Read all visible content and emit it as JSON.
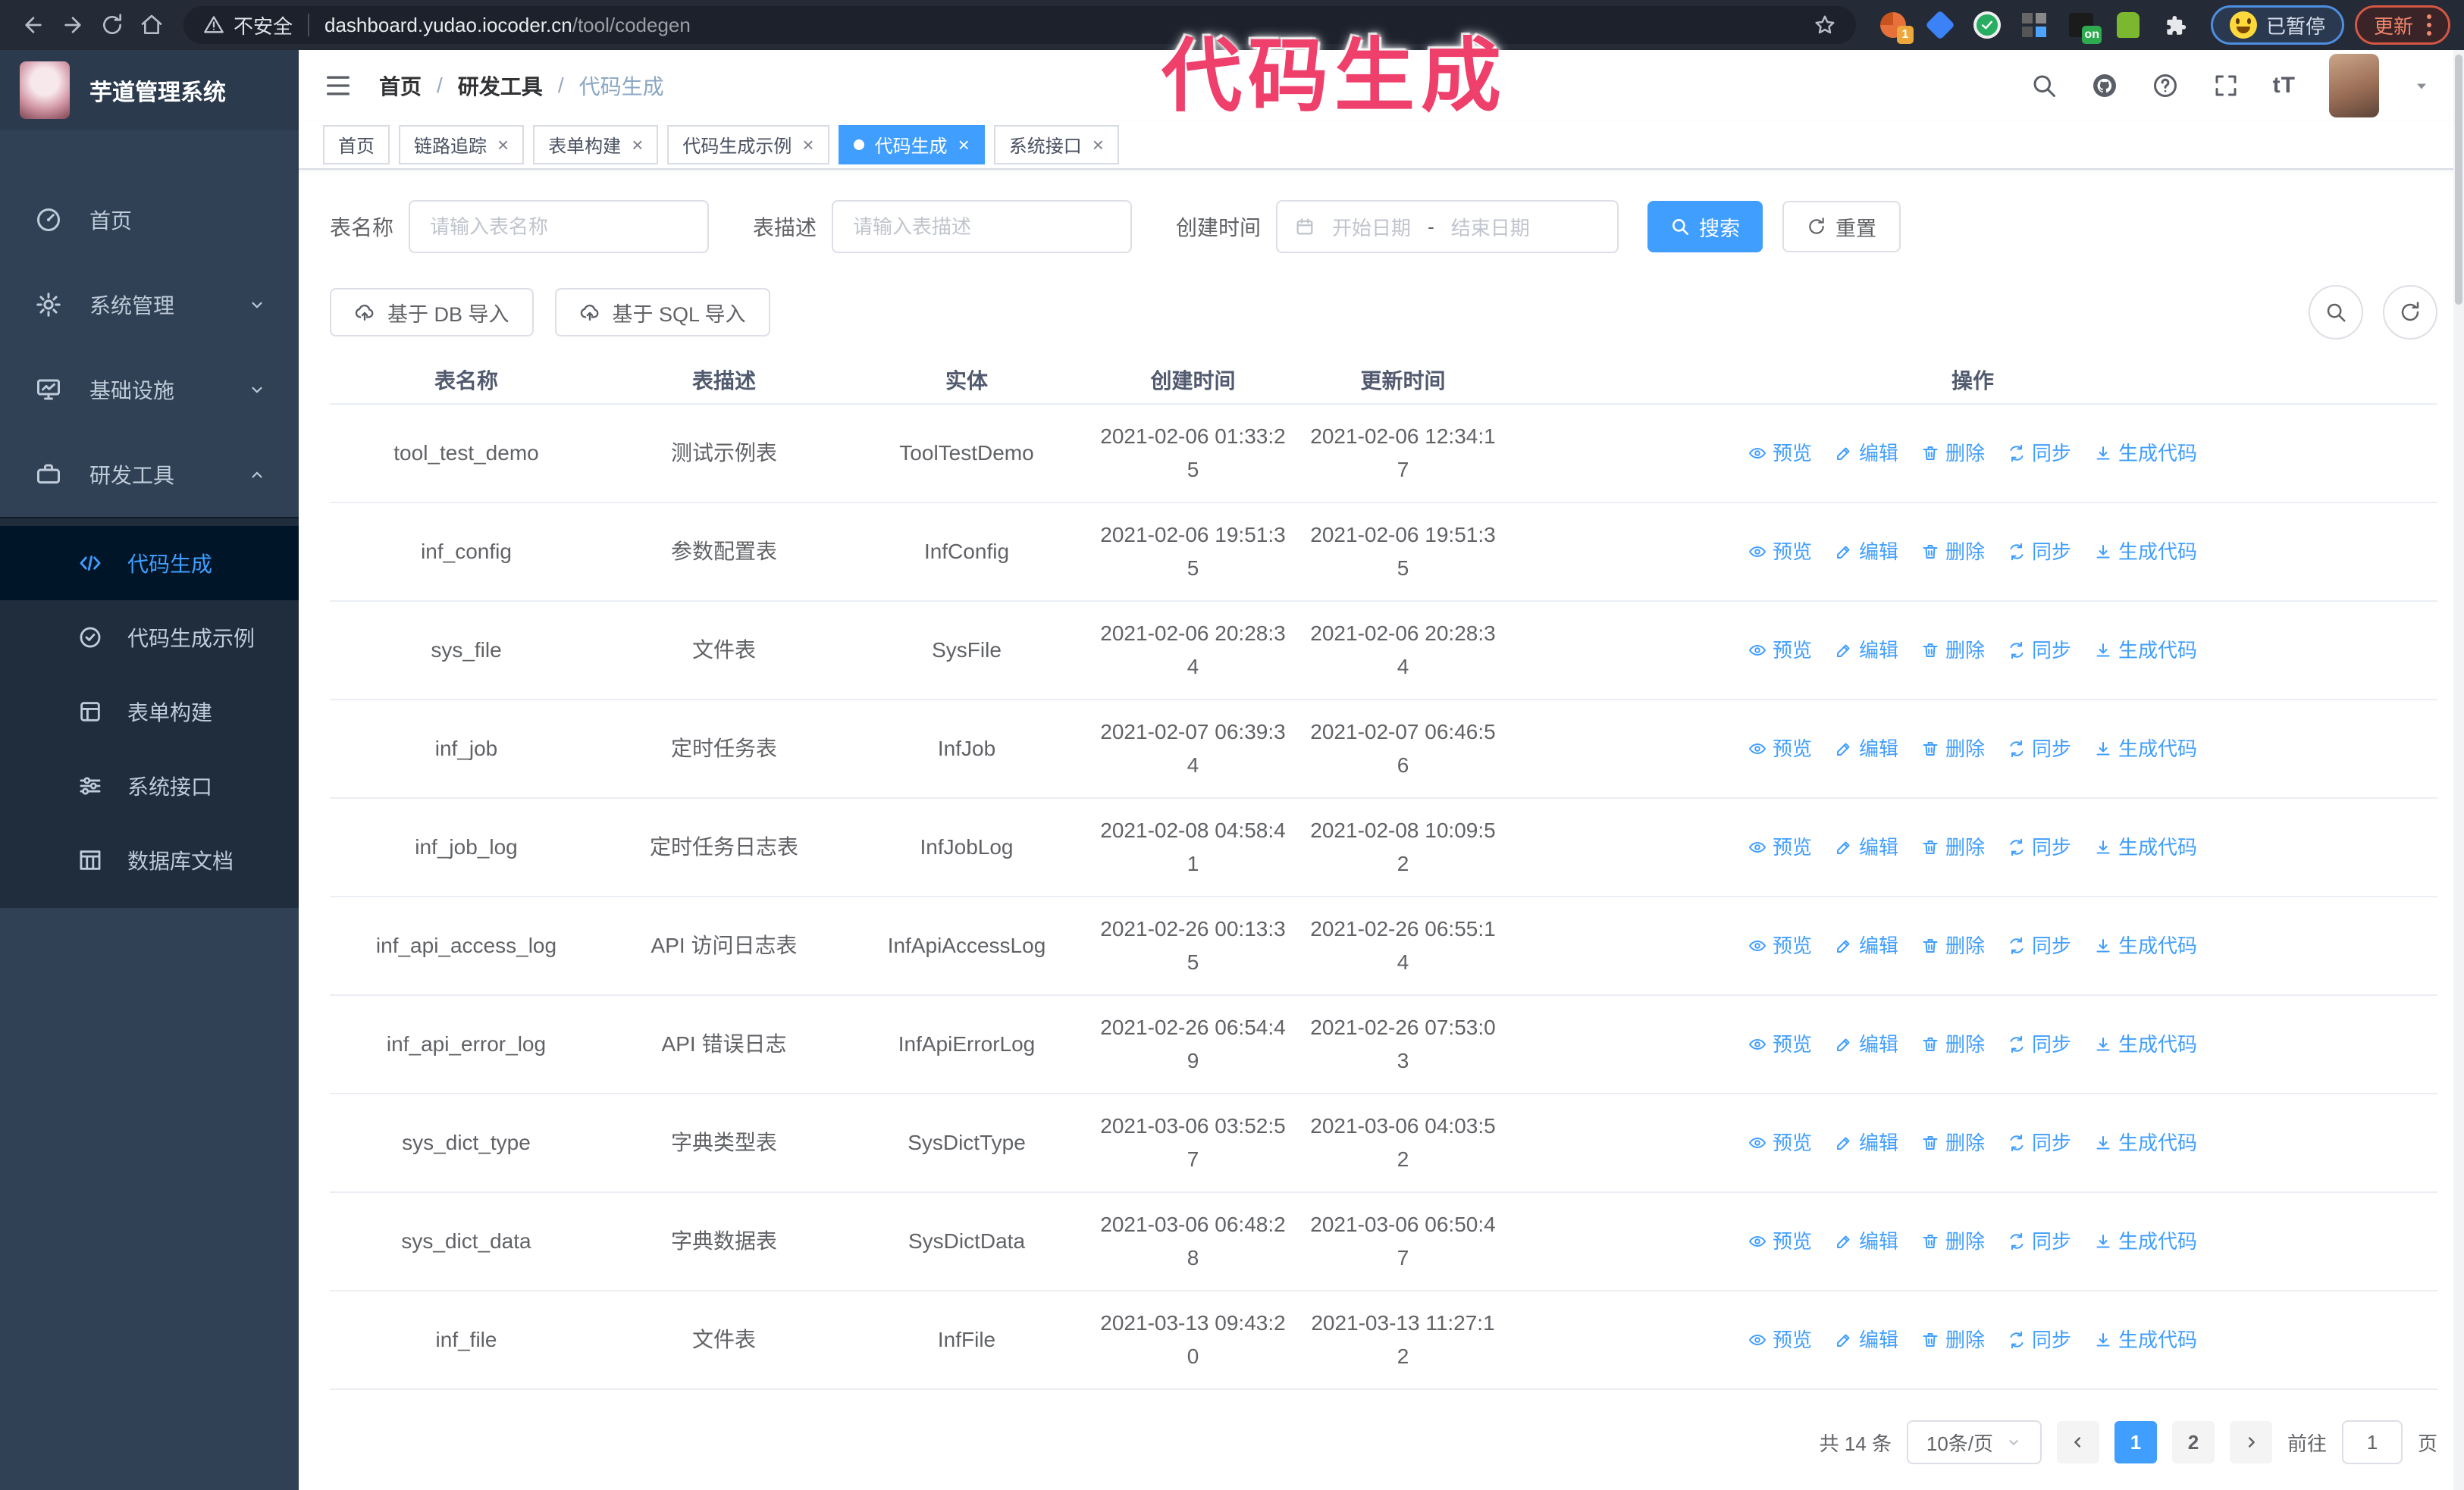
{
  "colors": {
    "accent": "#409eff",
    "sidebar_bg": "#304156",
    "submenu_bg": "#1f2d3d",
    "annotation_pink": "#ef3f6b",
    "chrome_bar": "#242a36"
  },
  "browser": {
    "nav_icons": [
      "back-icon",
      "forward-icon",
      "reload-icon",
      "home-icon"
    ],
    "security_label": "不安全",
    "url_host": "dashboard.yudao.iocoder.cn",
    "url_path": "/tool/codegen",
    "extension_icons": [
      "adguard-ext-icon",
      "gem-ext-icon",
      "check-ext-icon",
      "grid-ext-icon",
      "dark-ext-icon",
      "green-ext-icon",
      "puzzle-ext-icon"
    ],
    "ext_badge_1": "1",
    "ext_badge_on": "on",
    "paused_badge": "已暂停",
    "update_badge": "更新"
  },
  "annotation": {
    "text": "代码生成"
  },
  "sidebar": {
    "logo_title": "芋道管理系统",
    "menu": [
      {
        "label": "首页",
        "icon": "speedometer-icon",
        "expandable": false
      },
      {
        "label": "系统管理",
        "icon": "gear-icon",
        "expandable": true,
        "expanded": false
      },
      {
        "label": "基础设施",
        "icon": "monitor-icon",
        "expandable": true,
        "expanded": false
      },
      {
        "label": "研发工具",
        "icon": "briefcase-icon",
        "expandable": true,
        "expanded": true
      }
    ],
    "submenu": [
      {
        "label": "代码生成",
        "icon": "code-icon",
        "active": true
      },
      {
        "label": "代码生成示例",
        "icon": "badge-check-icon",
        "active": false
      },
      {
        "label": "表单构建",
        "icon": "form-icon",
        "active": false
      },
      {
        "label": "系统接口",
        "icon": "sliders-icon",
        "active": false
      },
      {
        "label": "数据库文档",
        "icon": "columns-icon",
        "active": false
      }
    ]
  },
  "header": {
    "breadcrumb": {
      "item1": "首页",
      "sep": "/",
      "item2": "研发工具",
      "item3": "代码生成"
    },
    "right_icons": [
      "search-icon",
      "github-icon",
      "question-icon",
      "fullscreen-icon",
      "font-size-icon",
      "avatar",
      "caret-down-icon"
    ],
    "font_size_glyph": "tT"
  },
  "tabs": [
    {
      "label": "首页",
      "closable": false,
      "active": false
    },
    {
      "label": "链路追踪",
      "closable": true,
      "active": false
    },
    {
      "label": "表单构建",
      "closable": true,
      "active": false
    },
    {
      "label": "代码生成示例",
      "closable": true,
      "active": false
    },
    {
      "label": "代码生成",
      "closable": true,
      "active": true
    },
    {
      "label": "系统接口",
      "closable": true,
      "active": false
    }
  ],
  "close_glyph": "×",
  "filters": {
    "table_name_label": "表名称",
    "table_name_placeholder": "请输入表名称",
    "table_desc_label": "表描述",
    "table_desc_placeholder": "请输入表描述",
    "create_time_label": "创建时间",
    "date_start_placeholder": "开始日期",
    "date_separator": "-",
    "date_end_placeholder": "结束日期",
    "search_label": "搜索",
    "reset_label": "重置"
  },
  "toolbar": {
    "import_db_label": "基于 DB 导入",
    "import_sql_label": "基于 SQL 导入",
    "right_icons": [
      "search-icon",
      "refresh-icon"
    ]
  },
  "table": {
    "columns": [
      "表名称",
      "表描述",
      "实体",
      "创建时间",
      "更新时间",
      "操作"
    ],
    "actions": [
      "预览",
      "编辑",
      "删除",
      "同步",
      "生成代码"
    ],
    "action_icons": [
      "eye-icon",
      "pencil-icon",
      "trash-icon",
      "sync-icon",
      "download-icon"
    ],
    "rows": [
      {
        "name": "tool_test_demo",
        "desc": "测试示例表",
        "entity": "ToolTestDemo",
        "created": "2021-02-06 01:33:25",
        "updated": "2021-02-06 12:34:17"
      },
      {
        "name": "inf_config",
        "desc": "参数配置表",
        "entity": "InfConfig",
        "created": "2021-02-06 19:51:35",
        "updated": "2021-02-06 19:51:35"
      },
      {
        "name": "sys_file",
        "desc": "文件表",
        "entity": "SysFile",
        "created": "2021-02-06 20:28:34",
        "updated": "2021-02-06 20:28:34"
      },
      {
        "name": "inf_job",
        "desc": "定时任务表",
        "entity": "InfJob",
        "created": "2021-02-07 06:39:34",
        "updated": "2021-02-07 06:46:56"
      },
      {
        "name": "inf_job_log",
        "desc": "定时任务日志表",
        "entity": "InfJobLog",
        "created": "2021-02-08 04:58:41",
        "updated": "2021-02-08 10:09:52"
      },
      {
        "name": "inf_api_access_log",
        "desc": "API 访问日志表",
        "entity": "InfApiAccessLog",
        "created": "2021-02-26 00:13:35",
        "updated": "2021-02-26 06:55:14"
      },
      {
        "name": "inf_api_error_log",
        "desc": "API 错误日志",
        "entity": "InfApiErrorLog",
        "created": "2021-02-26 06:54:49",
        "updated": "2021-02-26 07:53:03"
      },
      {
        "name": "sys_dict_type",
        "desc": "字典类型表",
        "entity": "SysDictType",
        "created": "2021-03-06 03:52:57",
        "updated": "2021-03-06 04:03:52"
      },
      {
        "name": "sys_dict_data",
        "desc": "字典数据表",
        "entity": "SysDictData",
        "created": "2021-03-06 06:48:28",
        "updated": "2021-03-06 06:50:47"
      },
      {
        "name": "inf_file",
        "desc": "文件表",
        "entity": "InfFile",
        "created": "2021-03-13 09:43:20",
        "updated": "2021-03-13 11:27:12"
      }
    ]
  },
  "pagination": {
    "total_label": "共 14 条",
    "page_size": "10条/页",
    "pages": [
      "1",
      "2"
    ],
    "active_page": "1",
    "goto_label": "前往",
    "goto_value": "1",
    "page_suffix": "页"
  }
}
